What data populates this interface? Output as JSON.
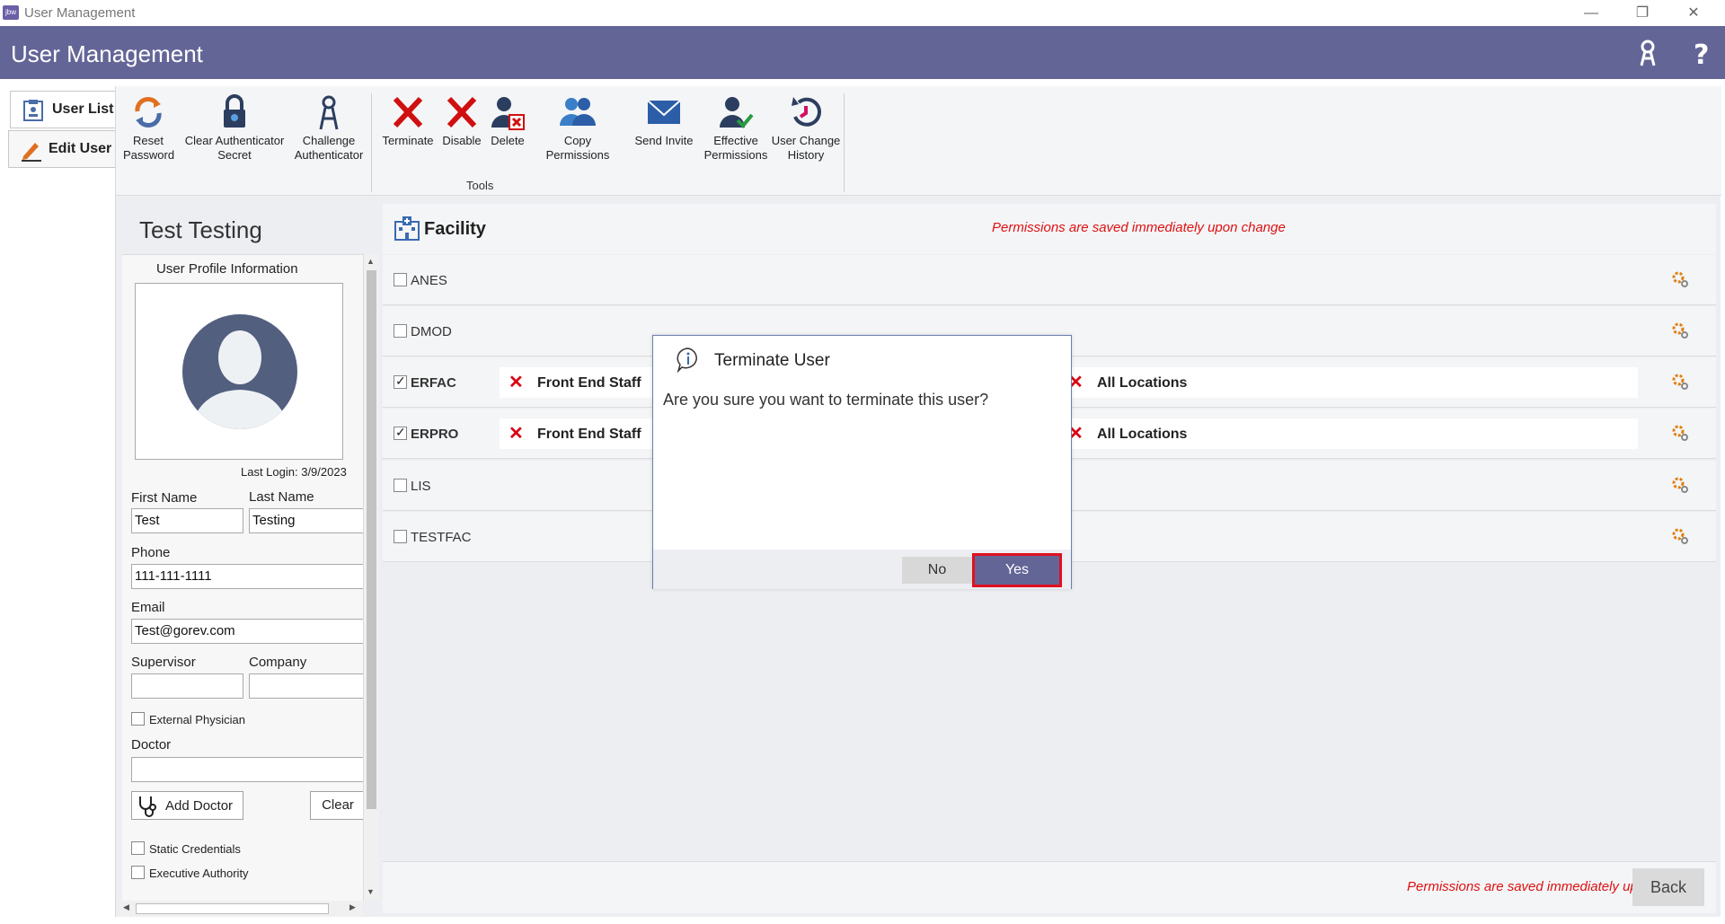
{
  "window": {
    "title": "User Management",
    "app_icon_text": "jbw"
  },
  "header": {
    "title": "User Management",
    "icons": [
      "key-user-icon",
      "help-icon"
    ]
  },
  "nav": {
    "tabs": [
      {
        "label": "User List"
      },
      {
        "label": "Edit User"
      }
    ]
  },
  "toolbar": {
    "group_label": "Tools",
    "buttons": [
      {
        "line1": "Reset",
        "line2": "Password"
      },
      {
        "line1": "Clear Authenticator",
        "line2": "Secret"
      },
      {
        "line1": "Challenge",
        "line2": "Authenticator"
      },
      {
        "line1": "Terminate",
        "line2": ""
      },
      {
        "line1": "Disable",
        "line2": ""
      },
      {
        "line1": "Delete",
        "line2": ""
      },
      {
        "line1": "Copy Permissions",
        "line2": ""
      },
      {
        "line1": "Send Invite",
        "line2": ""
      },
      {
        "line1": "Effective",
        "line2": "Permissions"
      },
      {
        "line1": "User Change",
        "line2": "History"
      }
    ]
  },
  "profile": {
    "name": "Test Testing",
    "section_title": "User Profile Information",
    "last_login": "Last Login: 3/9/2023",
    "first_name_label": "First Name",
    "first_name": "Test",
    "last_name_label": "Last Name",
    "last_name": "Testing",
    "phone_label": "Phone",
    "phone": "111-111-1111",
    "email_label": "Email",
    "email": "Test@gorev.com",
    "supervisor_label": "Supervisor",
    "supervisor": "",
    "company_label": "Company",
    "company": "",
    "external_physician_label": "External Physician",
    "doctor_label": "Doctor",
    "doctor": "",
    "add_doctor_label": "Add Doctor",
    "clear_label": "Clear",
    "static_credentials_label": "Static Credentials",
    "executive_authority_label": "Executive Authority"
  },
  "facility": {
    "title": "Facility",
    "note": "Permissions are saved immediately upon change",
    "rows": [
      {
        "code": "ANES",
        "checked": false
      },
      {
        "code": "DMOD",
        "checked": false
      },
      {
        "code": "ERFAC",
        "checked": true,
        "role": "Front End Staff",
        "location": "All Locations"
      },
      {
        "code": "ERPRO",
        "checked": true,
        "role": "Front End Staff",
        "location": "All Locations"
      },
      {
        "code": "LIS",
        "checked": false
      },
      {
        "code": "TESTFAC",
        "checked": false
      }
    ]
  },
  "bottom": {
    "note": "Permissions are saved immediately upon change",
    "back_label": "Back"
  },
  "dialog": {
    "title": "Terminate User",
    "message": "Are you sure you want to terminate this user?",
    "no_label": "No",
    "yes_label": "Yes"
  },
  "colors": {
    "header": "#646597",
    "accent_red": "#d11111",
    "yes_border": "#e01020"
  }
}
